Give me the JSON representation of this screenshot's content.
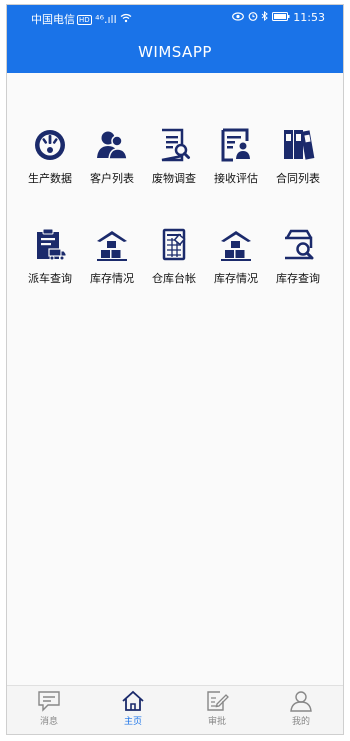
{
  "status_bar": {
    "carrier": "中国电信",
    "badge": "HD",
    "signal": "⁴⁶.ıll",
    "time": "11:53"
  },
  "header": {
    "title": "WIMSAPP"
  },
  "grid": [
    {
      "label": "生产数据",
      "icon": "gauge-icon"
    },
    {
      "label": "客户列表",
      "icon": "users-icon"
    },
    {
      "label": "废物调查",
      "icon": "document-search-icon"
    },
    {
      "label": "接收评估",
      "icon": "id-card-icon"
    },
    {
      "label": "合同列表",
      "icon": "binders-icon"
    },
    {
      "label": "派车查询",
      "icon": "truck-clipboard-icon"
    },
    {
      "label": "库存情况",
      "icon": "warehouse-icon"
    },
    {
      "label": "仓库台帐",
      "icon": "ledger-icon"
    },
    {
      "label": "库存情况",
      "icon": "warehouse-icon"
    },
    {
      "label": "库存查询",
      "icon": "stock-search-icon"
    }
  ],
  "tabbar": [
    {
      "label": "消息",
      "icon": "message-icon",
      "active": false
    },
    {
      "label": "主页",
      "icon": "home-icon",
      "active": true
    },
    {
      "label": "审批",
      "icon": "edit-icon",
      "active": false
    },
    {
      "label": "我的",
      "icon": "user-icon",
      "active": false
    }
  ],
  "colors": {
    "primary": "#1a73e8",
    "icon_navy": "#1b2a6b"
  }
}
